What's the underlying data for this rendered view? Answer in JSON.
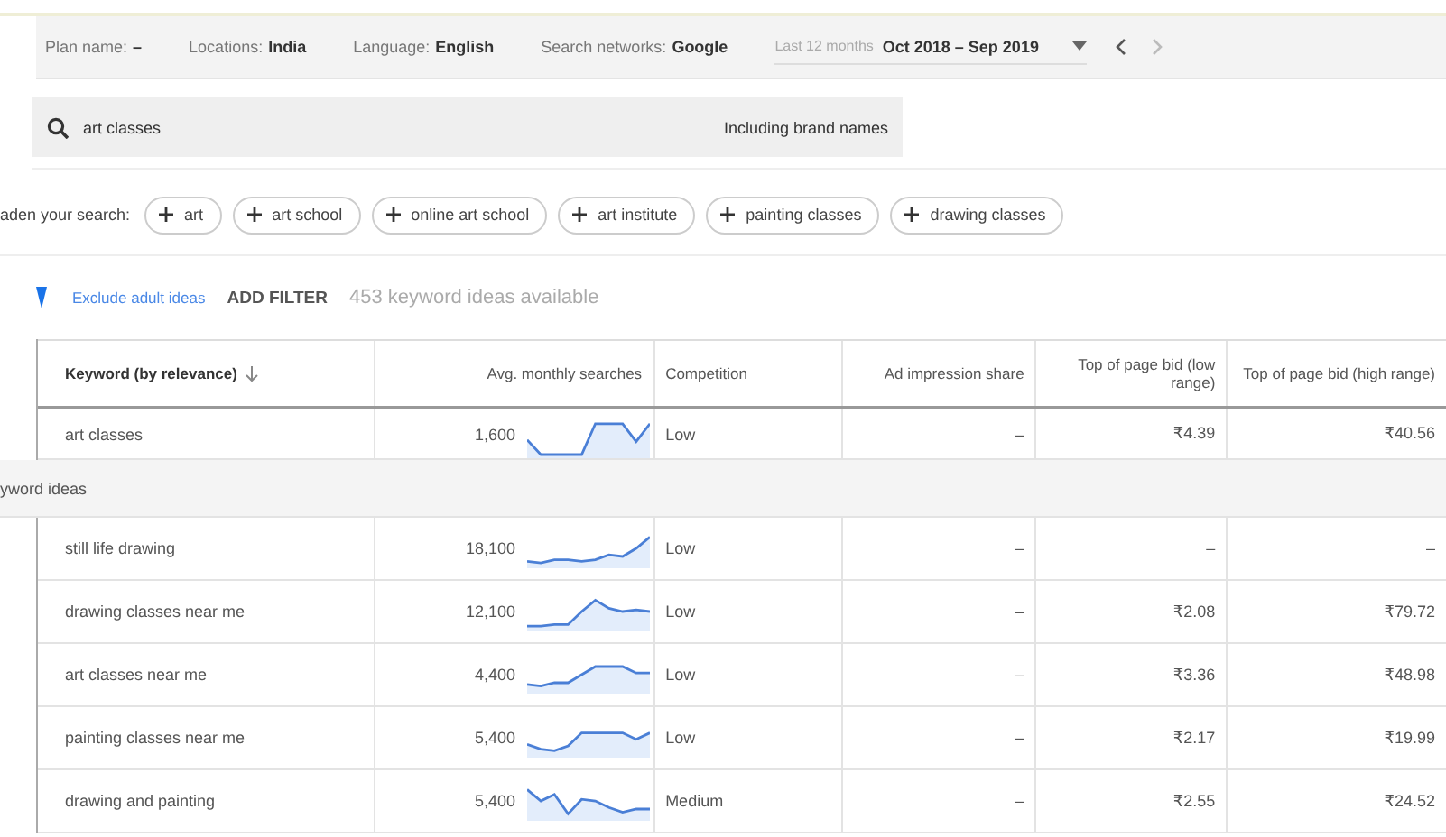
{
  "filters": [
    {
      "label": "Plan name:",
      "value": "–"
    },
    {
      "label": "Locations:",
      "value": "India"
    },
    {
      "label": "Language:",
      "value": "English"
    },
    {
      "label": "Search networks:",
      "value": "Google"
    }
  ],
  "date_range": {
    "label": "Last 12 months",
    "value": "Oct 2018 – Sep 2019"
  },
  "search": {
    "value": "art classes",
    "option": "Including brand names"
  },
  "broaden": {
    "label": "aden your search:",
    "chips": [
      "art",
      "art school",
      "online art school",
      "art institute",
      "painting classes",
      "drawing classes"
    ]
  },
  "filter_bar": {
    "link": "Exclude adult ideas",
    "button": "ADD FILTER",
    "count": "453 keyword ideas available"
  },
  "table": {
    "columns": [
      "Keyword (by relevance)",
      "Avg. monthly searches",
      "Competition",
      "Ad impression share",
      "Top of page bid (low range)",
      "Top of page bid (high range)"
    ],
    "searched_rows": [
      {
        "keyword": "art classes",
        "searches": "1,600",
        "competition": "Low",
        "impression": "–",
        "bid_low": "₹4.39",
        "bid_high": "₹40.56"
      }
    ],
    "section": "yword ideas",
    "rows": [
      {
        "keyword": "still life drawing",
        "searches": "18,100",
        "competition": "Low",
        "impression": "–",
        "bid_low": "–",
        "bid_high": "–"
      },
      {
        "keyword": "drawing classes near me",
        "searches": "12,100",
        "competition": "Low",
        "impression": "–",
        "bid_low": "₹2.08",
        "bid_high": "₹79.72"
      },
      {
        "keyword": "art classes near me",
        "searches": "4,400",
        "competition": "Low",
        "impression": "–",
        "bid_low": "₹3.36",
        "bid_high": "₹48.98"
      },
      {
        "keyword": "painting classes near me",
        "searches": "5,400",
        "competition": "Low",
        "impression": "–",
        "bid_low": "₹2.17",
        "bid_high": "₹19.99"
      },
      {
        "keyword": "drawing and painting",
        "searches": "5,400",
        "competition": "Medium",
        "impression": "–",
        "bid_low": "₹2.55",
        "bid_high": "₹24.52"
      }
    ]
  }
}
